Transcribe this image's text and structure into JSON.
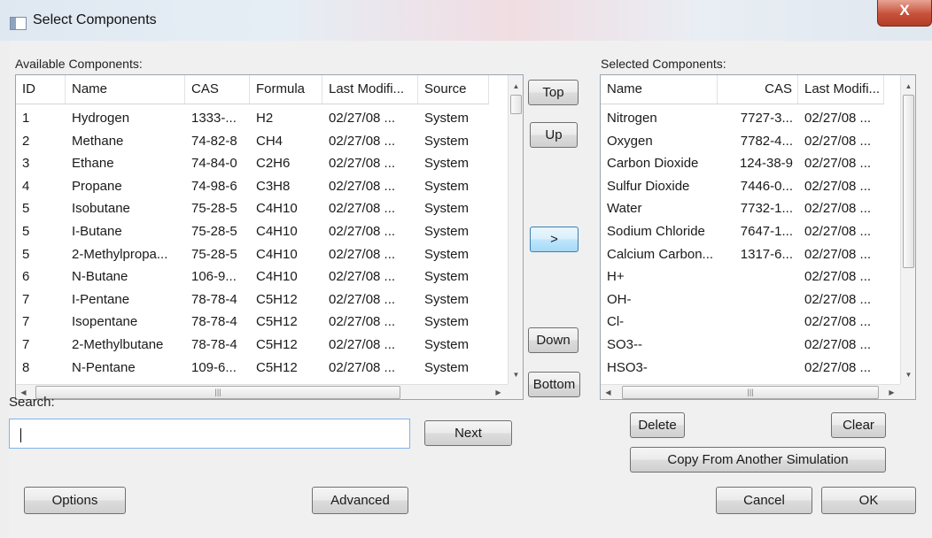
{
  "window": {
    "title": "Select Components",
    "close_label": "X"
  },
  "available": {
    "label": "Available Components:",
    "columns": [
      "ID",
      "Name",
      "CAS",
      "Formula",
      "Last Modifi...",
      "Source"
    ],
    "rows": [
      [
        "1",
        "Hydrogen",
        "1333-...",
        "H2",
        "02/27/08 ...",
        "System"
      ],
      [
        "2",
        "Methane",
        "74-82-8",
        "CH4",
        "02/27/08 ...",
        "System"
      ],
      [
        "3",
        "Ethane",
        "74-84-0",
        "C2H6",
        "02/27/08 ...",
        "System"
      ],
      [
        "4",
        "Propane",
        "74-98-6",
        "C3H8",
        "02/27/08 ...",
        "System"
      ],
      [
        "5",
        "Isobutane",
        "75-28-5",
        "C4H10",
        "02/27/08 ...",
        "System"
      ],
      [
        "5",
        "I-Butane",
        "75-28-5",
        "C4H10",
        "02/27/08 ...",
        "System"
      ],
      [
        "5",
        "2-Methylpropa...",
        "75-28-5",
        "C4H10",
        "02/27/08 ...",
        "System"
      ],
      [
        "6",
        "N-Butane",
        "106-9...",
        "C4H10",
        "02/27/08 ...",
        "System"
      ],
      [
        "7",
        "I-Pentane",
        "78-78-4",
        "C5H12",
        "02/27/08 ...",
        "System"
      ],
      [
        "7",
        "Isopentane",
        "78-78-4",
        "C5H12",
        "02/27/08 ...",
        "System"
      ],
      [
        "7",
        "2-Methylbutane",
        "78-78-4",
        "C5H12",
        "02/27/08 ...",
        "System"
      ],
      [
        "8",
        "N-Pentane",
        "109-6...",
        "C5H12",
        "02/27/08 ...",
        "System"
      ]
    ]
  },
  "selected": {
    "label": "Selected Components:",
    "columns": [
      "Name",
      "CAS",
      "Last Modifi..."
    ],
    "rows": [
      [
        "Nitrogen",
        "7727-3...",
        "02/27/08 ..."
      ],
      [
        "Oxygen",
        "7782-4...",
        "02/27/08 ..."
      ],
      [
        "Carbon Dioxide",
        "124-38-9",
        "02/27/08 ..."
      ],
      [
        "Sulfur Dioxide",
        "7446-0...",
        "02/27/08 ..."
      ],
      [
        "Water",
        "7732-1...",
        "02/27/08 ..."
      ],
      [
        "Sodium Chloride",
        "7647-1...",
        "02/27/08 ..."
      ],
      [
        "Calcium Carbon...",
        "1317-6...",
        "02/27/08 ..."
      ],
      [
        "H+",
        "",
        "02/27/08 ..."
      ],
      [
        "OH-",
        "",
        "02/27/08 ..."
      ],
      [
        "Cl-",
        "",
        "02/27/08 ..."
      ],
      [
        "SO3--",
        "",
        "02/27/08 ..."
      ],
      [
        "HSO3-",
        "",
        "02/27/08 ..."
      ]
    ]
  },
  "move_buttons": {
    "top": "Top",
    "up": "Up",
    "add": ">",
    "down": "Down",
    "bottom": "Bottom"
  },
  "search": {
    "label": "Search:",
    "value": "",
    "next": "Next"
  },
  "buttons": {
    "options": "Options",
    "advanced": "Advanced",
    "delete": "Delete",
    "clear": "Clear",
    "copy": "Copy From Another Simulation",
    "cancel": "Cancel",
    "ok": "OK"
  },
  "icons": {
    "scroll_up": "scroll-up-arrow-icon",
    "scroll_down": "scroll-down-arrow-icon",
    "grip": "scroll-grip-icon"
  }
}
